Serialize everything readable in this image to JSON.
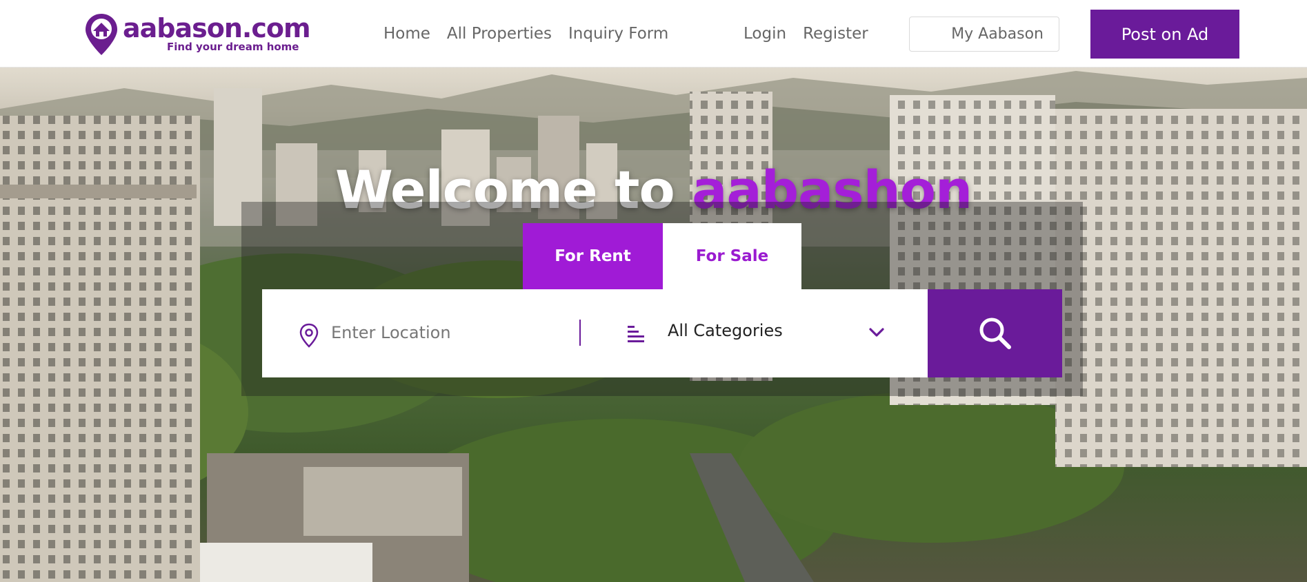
{
  "logo": {
    "name": "aabason.com",
    "tagline": "Find your dream home"
  },
  "nav": {
    "home": "Home",
    "all_properties": "All Properties",
    "inquiry_form": "Inquiry Form",
    "login": "Login",
    "register": "Register",
    "my_account": "My Aabason",
    "post_ad": "Post on Ad"
  },
  "hero": {
    "welcome_prefix": "Welcome to",
    "welcome_brand": "aabashon"
  },
  "search": {
    "tabs": [
      "For Rent",
      "For Sale"
    ],
    "active_tab": "For Rent",
    "location_placeholder": "Enter Location",
    "category_selected": "All Categories"
  },
  "colors": {
    "brand_purple": "#6a1b9a",
    "accent_purple": "#a01bd6",
    "text_gray": "#666666"
  },
  "icons": {
    "location": "map-pin-icon",
    "category": "list-icon",
    "dropdown": "chevron-down-icon",
    "search": "search-icon"
  }
}
